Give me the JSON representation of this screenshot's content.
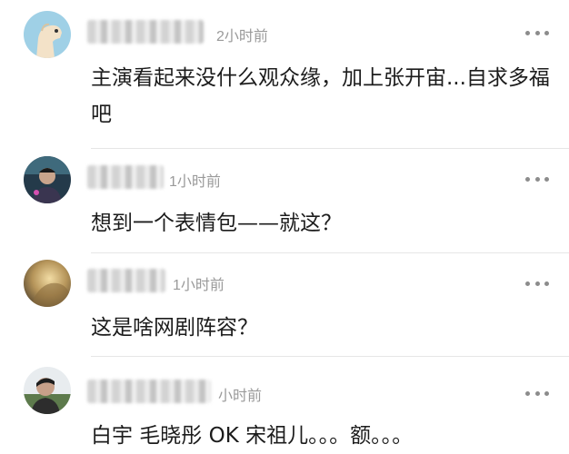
{
  "comments": [
    {
      "time": "2小时前",
      "text": "主演看起来没什么观众缘，加上张开宙...自求多福吧",
      "avatar": "dinosaur-avatar"
    },
    {
      "time": "1小时前",
      "text": "想到一个表情包——就这？",
      "avatar": "person-avatar"
    },
    {
      "time": "1小时前",
      "text": "这是啥网剧阵容？",
      "avatar": "golden-avatar"
    },
    {
      "time": "小时前",
      "text": "白宇 毛晓彤 OK 宋祖儿。。。额。。。",
      "avatar": "man-avatar"
    }
  ],
  "icons": {
    "more": "more-dots-icon"
  },
  "colors": {
    "time_text": "#9a9a9a",
    "comment_text": "#1c1c1c"
  }
}
